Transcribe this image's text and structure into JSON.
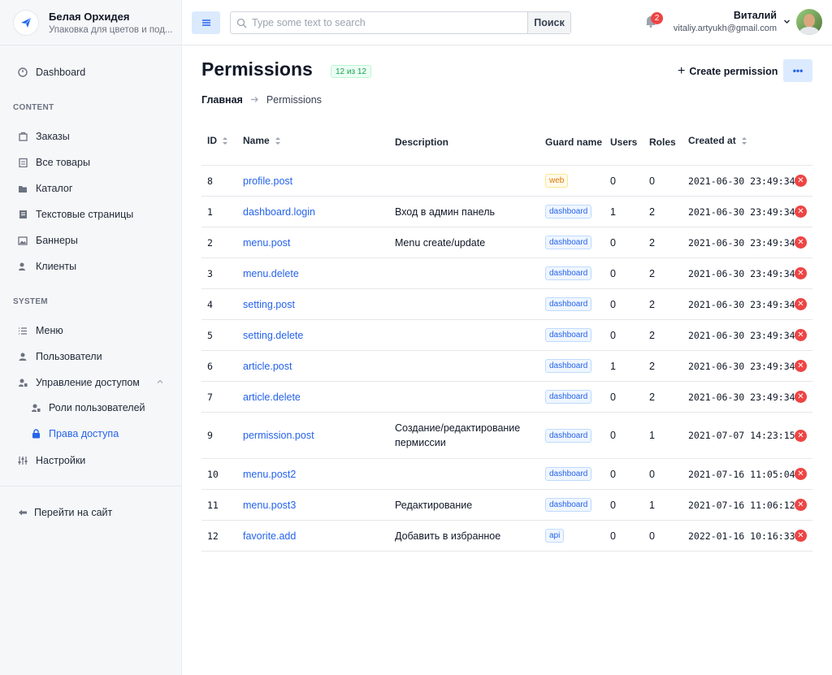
{
  "brand": {
    "name": "Белая Орхидея",
    "subtitle": "Упаковка для цветов и под..."
  },
  "sidebar": {
    "dashboard": "Dashboard",
    "content_title": "CONTENT",
    "content_items": [
      "Заказы",
      "Все товары",
      "Каталог",
      "Текстовые страницы",
      "Баннеры",
      "Клиенты"
    ],
    "system_title": "SYSTEM",
    "system_items": [
      "Меню",
      "Пользователи",
      "Управление доступом"
    ],
    "access_sub": [
      "Роли пользователей",
      "Права доступа"
    ],
    "settings": "Настройки",
    "go_site": "Перейти на сайт"
  },
  "topbar": {
    "search_placeholder": "Type some text to search",
    "search_button": "Поиск",
    "notifications": "2",
    "user_name": "Виталий",
    "user_email": "vitaliy.artyukh@gmail.com"
  },
  "page": {
    "title": "Permissions",
    "count": "12 из 12",
    "create": "Create permission",
    "breadcrumb_home": "Главная",
    "breadcrumb_current": "Permissions"
  },
  "table": {
    "headers": {
      "id": "ID",
      "name": "Name",
      "description": "Description",
      "guard": "Guard name",
      "users": "Users",
      "roles": "Roles",
      "created": "Created at"
    },
    "rows": [
      {
        "id": "8",
        "name": "profile.post",
        "desc": "",
        "guard": "web",
        "users": "0",
        "roles": "0",
        "created": "2021-06-30 23:49:34"
      },
      {
        "id": "1",
        "name": "dashboard.login",
        "desc": "Вход в админ панель",
        "guard": "dashboard",
        "users": "1",
        "roles": "2",
        "created": "2021-06-30 23:49:34"
      },
      {
        "id": "2",
        "name": "menu.post",
        "desc": "Menu create/update",
        "guard": "dashboard",
        "users": "0",
        "roles": "2",
        "created": "2021-06-30 23:49:34"
      },
      {
        "id": "3",
        "name": "menu.delete",
        "desc": "",
        "guard": "dashboard",
        "users": "0",
        "roles": "2",
        "created": "2021-06-30 23:49:34"
      },
      {
        "id": "4",
        "name": "setting.post",
        "desc": "",
        "guard": "dashboard",
        "users": "0",
        "roles": "2",
        "created": "2021-06-30 23:49:34"
      },
      {
        "id": "5",
        "name": "setting.delete",
        "desc": "",
        "guard": "dashboard",
        "users": "0",
        "roles": "2",
        "created": "2021-06-30 23:49:34"
      },
      {
        "id": "6",
        "name": "article.post",
        "desc": "",
        "guard": "dashboard",
        "users": "1",
        "roles": "2",
        "created": "2021-06-30 23:49:34"
      },
      {
        "id": "7",
        "name": "article.delete",
        "desc": "",
        "guard": "dashboard",
        "users": "0",
        "roles": "2",
        "created": "2021-06-30 23:49:34"
      },
      {
        "id": "9",
        "name": "permission.post",
        "desc": "Создание/редактирование пермиссии",
        "guard": "dashboard",
        "users": "0",
        "roles": "1",
        "created": "2021-07-07 14:23:15"
      },
      {
        "id": "10",
        "name": "menu.post2",
        "desc": "",
        "guard": "dashboard",
        "users": "0",
        "roles": "0",
        "created": "2021-07-16 11:05:04"
      },
      {
        "id": "11",
        "name": "menu.post3",
        "desc": "Редактирование",
        "guard": "dashboard",
        "users": "0",
        "roles": "1",
        "created": "2021-07-16 11:06:12"
      },
      {
        "id": "12",
        "name": "favorite.add",
        "desc": "Добавить в избранное",
        "guard": "api",
        "users": "0",
        "roles": "0",
        "created": "2022-01-16 10:16:33"
      }
    ]
  }
}
